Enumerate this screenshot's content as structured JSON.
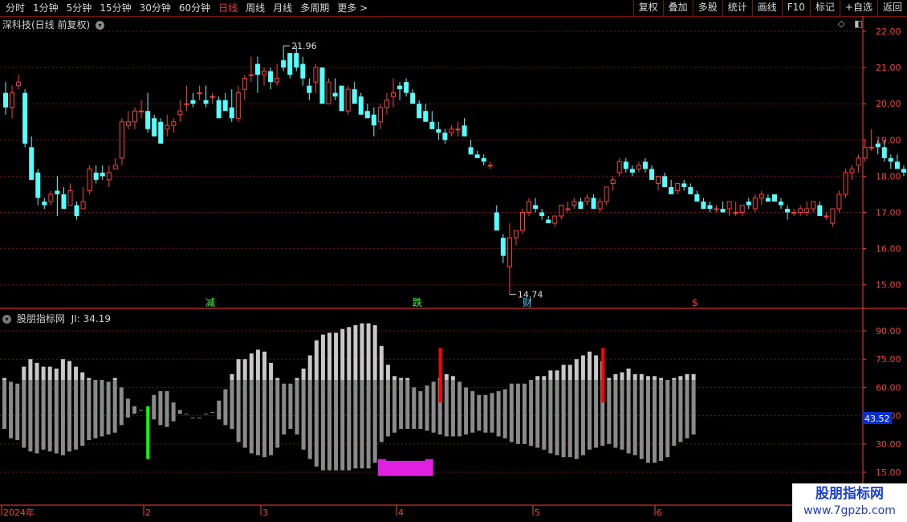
{
  "toolbar": {
    "periods": [
      "分时",
      "1分钟",
      "5分钟",
      "15分钟",
      "30分钟",
      "60分钟",
      "日线",
      "周线",
      "月线",
      "多周期",
      "更多 >"
    ],
    "active": "日线",
    "buttons": [
      "复权",
      "叠加",
      "多股",
      "统计",
      "画线",
      "F10",
      "标记",
      "+自选",
      "返回"
    ]
  },
  "main_header": {
    "title": "深科技(日线 前复权)",
    "chevron": "chevron-down-icon"
  },
  "indicator_header": {
    "title": "股朋指标网",
    "value_label": "JI: 34.19",
    "chevron": "chevron-down-icon"
  },
  "watermark": {
    "line1": "股朋指标网",
    "line2": "www.7gpzb.com"
  },
  "colors": {
    "up": "#ff3c3c",
    "down": "#54ffff",
    "grid": "#7a1010",
    "axis": "#ff3c3c"
  },
  "chart_data": [
    {
      "type": "candlestick",
      "ylim": [
        14.6,
        22.3
      ],
      "yticks": [
        "22.00",
        "21.00",
        "20.00",
        "19.00",
        "18.00",
        "17.00",
        "16.00",
        "15.00"
      ],
      "annotations": {
        "high": "21.96",
        "low": "14.74"
      },
      "events": [
        "减",
        "跌",
        "财",
        "$"
      ],
      "ohlc": [
        [
          20.3,
          20.6,
          19.7,
          19.9
        ],
        [
          19.9,
          20.5,
          19.6,
          20.3
        ],
        [
          20.5,
          20.8,
          20.4,
          20.6
        ],
        [
          20.3,
          20.4,
          18.8,
          18.9
        ],
        [
          18.8,
          19.1,
          17.9,
          17.9
        ],
        [
          18.1,
          18.2,
          17.2,
          17.4
        ],
        [
          17.3,
          17.4,
          17.1,
          17.2
        ],
        [
          17.3,
          17.6,
          17.2,
          17.5
        ],
        [
          17.6,
          18.0,
          16.9,
          17.5
        ],
        [
          17.5,
          17.7,
          17.1,
          17.1
        ],
        [
          17.2,
          17.8,
          17.2,
          17.6
        ],
        [
          17.2,
          17.3,
          16.8,
          16.9
        ],
        [
          17.1,
          17.7,
          17.1,
          17.3
        ],
        [
          17.6,
          18.3,
          17.5,
          18.2
        ],
        [
          18.1,
          18.3,
          17.8,
          17.9
        ],
        [
          18.1,
          18.3,
          17.9,
          18.0
        ],
        [
          17.9,
          18.3,
          17.7,
          18.1
        ],
        [
          18.2,
          18.5,
          18.2,
          18.3
        ],
        [
          18.5,
          19.6,
          18.3,
          19.5
        ],
        [
          19.4,
          19.8,
          19.3,
          19.5
        ],
        [
          19.5,
          19.9,
          19.3,
          19.8
        ],
        [
          19.8,
          20.1,
          19.6,
          19.8
        ],
        [
          19.8,
          20.3,
          19.2,
          19.3
        ],
        [
          19.6,
          19.7,
          19.1,
          19.1
        ],
        [
          19.5,
          19.6,
          18.9,
          18.9
        ],
        [
          19.3,
          19.7,
          19.1,
          19.4
        ],
        [
          19.4,
          19.6,
          19.2,
          19.5
        ],
        [
          19.7,
          20.1,
          19.5,
          19.8
        ],
        [
          20.0,
          20.5,
          19.8,
          20.0
        ],
        [
          20.1,
          20.3,
          19.9,
          20.0
        ],
        [
          20.3,
          20.5,
          20.1,
          20.3
        ],
        [
          20.1,
          20.5,
          19.9,
          20.0
        ],
        [
          20.2,
          20.3,
          20.0,
          20.2
        ],
        [
          20.1,
          20.2,
          19.6,
          19.6
        ],
        [
          20.1,
          20.3,
          19.8,
          19.8
        ],
        [
          19.9,
          20.4,
          19.5,
          19.6
        ],
        [
          19.6,
          20.5,
          19.5,
          20.3
        ],
        [
          20.4,
          20.8,
          20.1,
          20.7
        ],
        [
          20.8,
          21.3,
          20.6,
          20.8
        ],
        [
          21.1,
          21.3,
          20.3,
          20.8
        ],
        [
          20.8,
          21.0,
          20.5,
          20.9
        ],
        [
          20.9,
          21.0,
          20.4,
          20.6
        ],
        [
          20.6,
          21.1,
          20.5,
          20.7
        ],
        [
          21.2,
          21.6,
          20.9,
          21.0
        ],
        [
          21.4,
          21.4,
          20.7,
          20.8
        ],
        [
          21.4,
          21.6,
          20.9,
          21.0
        ],
        [
          21.1,
          21.3,
          20.5,
          20.7
        ],
        [
          20.5,
          20.7,
          20.1,
          20.3
        ],
        [
          20.6,
          21.1,
          20.3,
          21.0
        ],
        [
          21.0,
          21.0,
          20.1,
          20.0
        ],
        [
          20.0,
          20.7,
          20.0,
          20.6
        ],
        [
          20.3,
          20.7,
          20.1,
          20.2
        ],
        [
          20.5,
          20.5,
          19.8,
          19.8
        ],
        [
          19.8,
          20.5,
          19.7,
          20.4
        ],
        [
          20.4,
          20.6,
          20.0,
          20.0
        ],
        [
          20.2,
          20.3,
          19.7,
          19.7
        ],
        [
          19.8,
          20.0,
          19.6,
          19.6
        ],
        [
          19.7,
          19.9,
          19.1,
          19.4
        ],
        [
          19.5,
          20.0,
          19.3,
          19.9
        ],
        [
          19.9,
          20.3,
          19.7,
          20.1
        ],
        [
          20.2,
          20.7,
          19.9,
          20.3
        ],
        [
          20.5,
          20.6,
          20.1,
          20.4
        ],
        [
          20.6,
          20.7,
          20.2,
          20.3
        ],
        [
          20.3,
          20.4,
          20.1,
          20.0
        ],
        [
          20.0,
          20.1,
          19.7,
          19.6
        ],
        [
          19.8,
          20.0,
          19.6,
          19.5
        ],
        [
          19.5,
          19.8,
          19.4,
          19.3
        ],
        [
          19.3,
          19.5,
          19.0,
          19.2
        ],
        [
          19.2,
          19.3,
          18.9,
          19.0
        ],
        [
          19.2,
          19.4,
          19.1,
          19.3
        ],
        [
          19.3,
          19.5,
          19.1,
          19.3
        ],
        [
          19.4,
          19.6,
          19.2,
          19.1
        ],
        [
          18.8,
          19.0,
          18.6,
          18.6
        ],
        [
          18.6,
          18.7,
          18.5,
          18.5
        ],
        [
          18.5,
          18.6,
          18.3,
          18.4
        ],
        [
          18.3,
          18.4,
          18.2,
          18.3
        ],
        [
          17.0,
          17.2,
          16.7,
          16.5
        ],
        [
          16.3,
          16.4,
          15.6,
          15.8
        ],
        [
          15.5,
          16.7,
          14.74,
          16.3
        ],
        [
          16.3,
          16.5,
          16.1,
          16.5
        ],
        [
          16.5,
          17.1,
          16.4,
          17.0
        ],
        [
          17.0,
          17.4,
          16.9,
          17.3
        ],
        [
          17.2,
          17.4,
          17.0,
          17.1
        ],
        [
          17.0,
          17.1,
          16.8,
          16.9
        ],
        [
          16.8,
          16.9,
          16.7,
          16.7
        ],
        [
          16.7,
          16.9,
          16.6,
          16.9
        ],
        [
          16.9,
          17.2,
          16.8,
          17.2
        ],
        [
          17.1,
          17.3,
          17.0,
          17.1
        ],
        [
          17.2,
          17.4,
          17.1,
          17.3
        ],
        [
          17.3,
          17.4,
          17.1,
          17.1
        ],
        [
          17.3,
          17.5,
          17.2,
          17.4
        ],
        [
          17.4,
          17.5,
          17.1,
          17.1
        ],
        [
          17.1,
          17.4,
          17.0,
          17.3
        ],
        [
          17.3,
          17.7,
          17.2,
          17.7
        ],
        [
          17.8,
          18.0,
          17.6,
          17.9
        ],
        [
          18.1,
          18.5,
          18.0,
          18.4
        ],
        [
          18.4,
          18.5,
          18.1,
          18.2
        ],
        [
          18.2,
          18.3,
          18.0,
          18.1
        ],
        [
          18.2,
          18.4,
          18.1,
          18.3
        ],
        [
          18.4,
          18.5,
          18.1,
          18.2
        ],
        [
          18.2,
          18.3,
          17.9,
          17.9
        ],
        [
          17.8,
          18.0,
          17.6,
          18.0
        ],
        [
          18.0,
          18.1,
          17.7,
          17.7
        ],
        [
          17.7,
          17.9,
          17.5,
          17.5
        ],
        [
          17.6,
          17.8,
          17.5,
          17.8
        ],
        [
          17.8,
          17.9,
          17.6,
          17.7
        ],
        [
          17.7,
          17.8,
          17.5,
          17.5
        ],
        [
          17.5,
          17.6,
          17.3,
          17.3
        ],
        [
          17.3,
          17.4,
          17.1,
          17.1
        ],
        [
          17.2,
          17.3,
          17.0,
          17.1
        ],
        [
          17.1,
          17.2,
          17.0,
          17.1
        ],
        [
          17.1,
          17.3,
          17.0,
          17.0
        ],
        [
          17.1,
          17.3,
          16.9,
          17.3
        ],
        [
          17.0,
          17.3,
          16.9,
          17.0
        ],
        [
          17.0,
          17.2,
          16.9,
          17.2
        ],
        [
          17.3,
          17.4,
          17.1,
          17.2
        ],
        [
          17.1,
          17.5,
          17.0,
          17.4
        ],
        [
          17.4,
          17.6,
          17.2,
          17.5
        ],
        [
          17.4,
          17.5,
          17.3,
          17.3
        ],
        [
          17.5,
          17.5,
          17.3,
          17.3
        ],
        [
          17.3,
          17.4,
          17.1,
          17.2
        ],
        [
          17.1,
          17.2,
          16.8,
          17.0
        ],
        [
          17.0,
          17.1,
          16.9,
          17.0
        ],
        [
          17.0,
          17.2,
          16.9,
          17.1
        ],
        [
          17.0,
          17.3,
          16.9,
          17.1
        ],
        [
          17.1,
          17.3,
          17.0,
          17.3
        ],
        [
          17.2,
          17.3,
          16.9,
          16.9
        ],
        [
          16.9,
          17.0,
          16.8,
          16.9
        ],
        [
          16.7,
          17.1,
          16.6,
          17.1
        ],
        [
          17.1,
          17.6,
          17.0,
          17.5
        ],
        [
          17.5,
          18.2,
          17.4,
          18.1
        ],
        [
          18.1,
          18.3,
          17.9,
          18.2
        ],
        [
          18.3,
          18.6,
          18.1,
          18.5
        ],
        [
          18.5,
          19.0,
          18.4,
          18.8
        ],
        [
          18.8,
          19.3,
          18.7,
          18.8
        ],
        [
          18.9,
          19.0,
          18.6,
          18.8
        ],
        [
          18.8,
          19.0,
          18.4,
          18.5
        ],
        [
          18.5,
          18.6,
          18.2,
          18.4
        ],
        [
          18.4,
          18.6,
          18.2,
          18.2
        ],
        [
          18.2,
          18.3,
          18.0,
          18.1
        ],
        [
          18.9,
          19.4,
          18.7,
          18.8
        ],
        [
          18.8,
          18.9,
          18.5,
          18.6
        ],
        [
          18.5,
          18.6,
          18.3,
          18.4
        ],
        [
          18.3,
          18.7,
          18.2,
          18.5
        ]
      ]
    },
    {
      "type": "bar",
      "ylim": [
        12,
        98
      ],
      "yticks": [
        "90.00",
        "75.00",
        "60.00",
        "45.00",
        "30.00",
        "15.00"
      ],
      "current_value": "43.52",
      "upper": [
        65,
        63,
        62,
        71,
        75,
        73,
        71,
        71,
        70,
        75,
        74,
        71,
        68,
        65,
        64,
        64,
        63,
        65,
        60,
        54,
        50,
        48,
        48,
        56,
        58,
        58,
        52,
        48,
        46,
        44,
        44,
        46,
        47,
        53,
        59,
        67,
        75,
        75,
        78,
        80,
        79,
        73,
        65,
        62,
        62,
        65,
        70,
        77,
        85,
        88,
        89,
        89,
        91,
        92,
        93,
        94,
        94,
        93,
        82,
        72,
        66,
        65,
        65,
        60,
        58,
        61,
        63,
        65,
        67,
        66,
        63,
        60,
        58,
        56,
        56,
        57,
        58,
        59,
        62,
        62,
        62,
        64,
        66,
        66,
        69,
        69,
        72,
        72,
        75,
        77,
        79,
        77,
        74,
        65,
        67,
        68,
        70,
        67,
        67,
        66,
        66,
        65,
        64,
        65,
        66,
        67,
        67
      ],
      "lower": [
        38,
        33,
        32,
        28,
        26,
        25,
        27,
        26,
        25,
        24,
        26,
        27,
        29,
        32,
        33,
        34,
        35,
        36,
        40,
        44,
        46,
        48,
        48,
        43,
        40,
        39,
        42,
        46,
        49,
        50,
        51,
        49,
        48,
        43,
        40,
        38,
        31,
        28,
        25,
        24,
        23,
        24,
        28,
        35,
        38,
        35,
        27,
        22,
        18,
        16,
        16,
        16,
        16,
        16,
        17,
        17,
        17,
        20,
        31,
        34,
        36,
        38,
        38,
        38,
        38,
        37,
        36,
        35,
        34,
        34,
        34,
        35,
        36,
        37,
        36,
        36,
        34,
        33,
        31,
        30,
        30,
        29,
        28,
        27,
        25,
        24,
        23,
        23,
        22,
        24,
        27,
        28,
        29,
        30,
        28,
        27,
        25,
        24,
        22,
        20,
        20,
        21,
        23,
        29,
        31,
        33,
        35
      ],
      "markers": [
        {
          "index": 22,
          "color": "#00ff00",
          "top": 50,
          "bottom": 22
        },
        {
          "index": 67,
          "color": "#ff0000",
          "top": 81,
          "bottom": 52
        },
        {
          "index": 92,
          "color": "#ff0000",
          "top": 81,
          "bottom": 52
        }
      ],
      "pink_range": [
        58,
        66
      ],
      "x_labels": [
        "2024年",
        "2",
        "3",
        "4",
        "5",
        "6"
      ]
    }
  ]
}
